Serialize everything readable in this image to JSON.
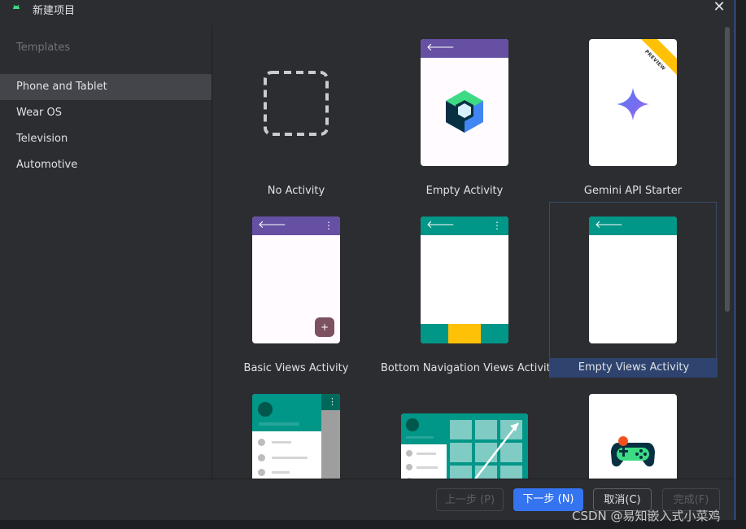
{
  "window": {
    "title": "新建项目"
  },
  "sidebar": {
    "header": "Templates",
    "items": [
      {
        "label": "Phone and Tablet",
        "selected": true
      },
      {
        "label": "Wear OS",
        "selected": false
      },
      {
        "label": "Television",
        "selected": false
      },
      {
        "label": "Automotive",
        "selected": false
      }
    ]
  },
  "templates": [
    {
      "label": "No Activity"
    },
    {
      "label": "Empty Activity"
    },
    {
      "label": "Gemini API Starter",
      "badge": "PREVIEW"
    },
    {
      "label": "Basic Views Activity"
    },
    {
      "label": "Bottom Navigation Views Activity"
    },
    {
      "label": "Empty Views Activity",
      "selected": true
    },
    {
      "label": ""
    },
    {
      "label": ""
    },
    {
      "label": ""
    }
  ],
  "colors": {
    "purple_appbar": "#6650a4",
    "teal_appbar": "#009688",
    "fab": "#7d5260",
    "accent_blue": "#3574f0",
    "yellow": "#ffc107"
  },
  "footer": {
    "previous_label": "上一步 (P)",
    "next_label": "下一步 (N)",
    "cancel_label": "取消(C)",
    "finish_label": "完成(F)"
  },
  "watermark": "CSDN @易知嵌入式小菜鸡"
}
